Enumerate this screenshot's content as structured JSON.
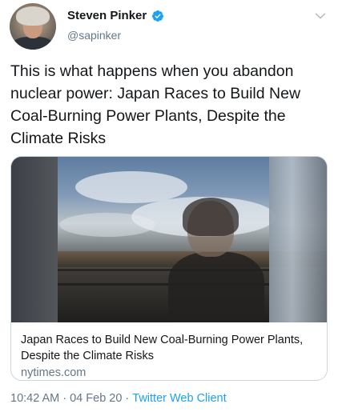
{
  "author": {
    "name": "Steven Pinker",
    "handle": "@sapinker",
    "verified": true
  },
  "tweet": {
    "text": "This is what happens when you abandon nuclear power: Japan Races to Build New Coal-Burning Power Plants, Despite the Climate Risks"
  },
  "card": {
    "title": "Japan Races to Build New Coal-Burning Power Plants, Despite the Climate Risks",
    "domain": "nytimes.com"
  },
  "meta": {
    "time": "10:42 AM",
    "separator1": "·",
    "date": "04 Feb 20",
    "separator2": "·",
    "client": "Twitter Web Client"
  },
  "colors": {
    "verified": "#1da1f2",
    "link": "#1da1f2",
    "secondary_text": "#657786"
  },
  "icons": {
    "verified": "verified-badge-icon",
    "menu": "chevron-down-icon"
  }
}
